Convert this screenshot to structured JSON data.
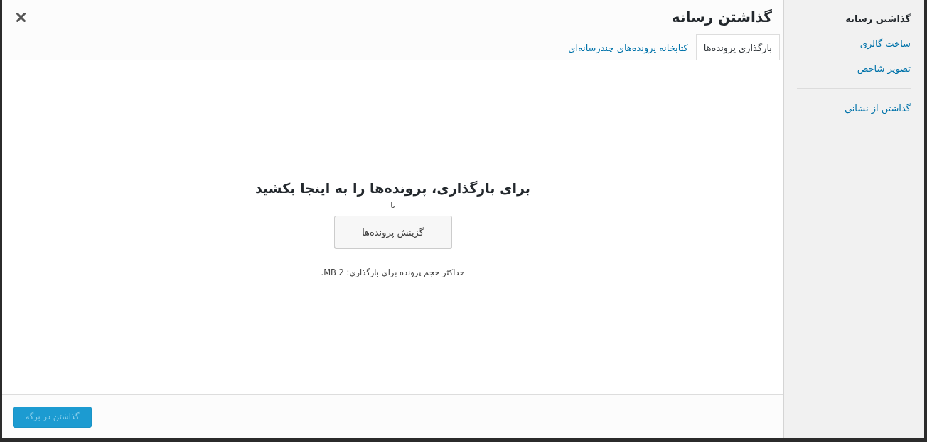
{
  "dialog": {
    "title": "گذاشتن رسانه"
  },
  "tabs": [
    {
      "label": "بارگذاری پرونده‌ها",
      "selected": true
    },
    {
      "label": "کتابخانه پرونده‌های چندرسانه‌ای",
      "selected": false
    }
  ],
  "uploader": {
    "heading": "برای بارگذاری، پرونده‌ها را به اینجا بکشید",
    "separator": "یا",
    "button": "گزینش پرونده‌ها",
    "note": "حداکثر حجم پرونده برای بارگذاری: 2 MB."
  },
  "footer_button": {
    "label": "گذاشتن در برگه",
    "disabled": true
  },
  "sidebar": {
    "groups": [
      {
        "items": [
          {
            "label": "گذاشتن رسانه",
            "selected": true
          },
          {
            "label": "ساخت گالری",
            "selected": false
          },
          {
            "label": "تصویر شاخص",
            "selected": false
          }
        ]
      },
      {
        "items": [
          {
            "label": "گذاشتن از نشانی",
            "selected": false
          }
        ]
      }
    ]
  }
}
